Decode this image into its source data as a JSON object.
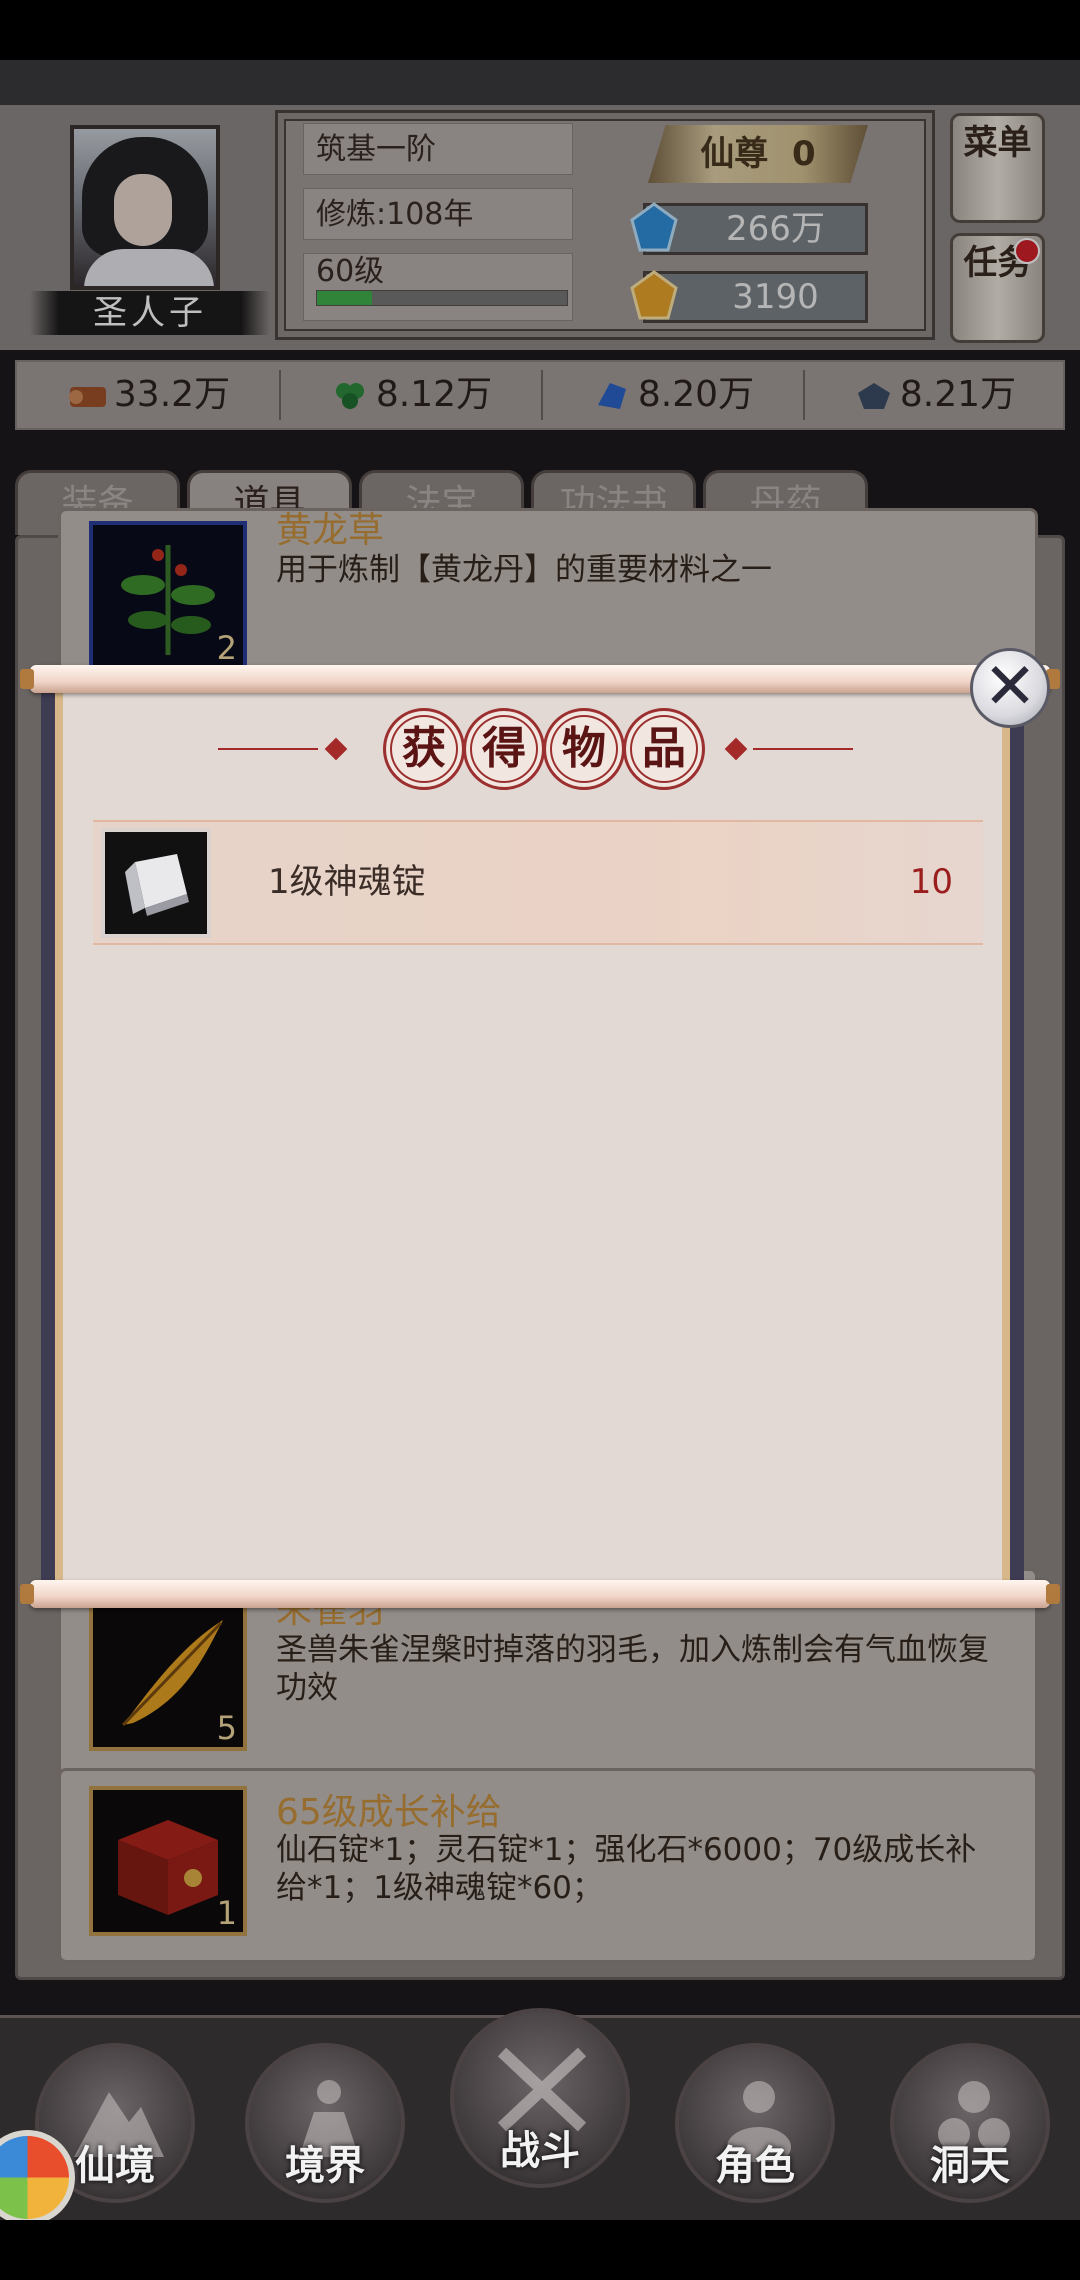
{
  "header": {
    "player_name": "圣人子",
    "realm": "筑基一阶",
    "cultivation": "修炼:108年",
    "level": "60级",
    "level_progress": 0.22,
    "rank_label": "仙尊",
    "rank_value": "0",
    "gems": [
      "266万",
      "3190"
    ],
    "side_buttons": [
      "菜单",
      "任务"
    ]
  },
  "resources": [
    "33.2万",
    "8.12万",
    "8.20万",
    "8.21万"
  ],
  "tabs": [
    "装备",
    "道具",
    "法宝",
    "功法书",
    "丹药"
  ],
  "active_tab": "道具",
  "items": [
    {
      "title": "黄龙草",
      "count": "2",
      "desc": "用于炼制【黄龙丹】的重要材料之一"
    },
    {
      "title": "朱雀羽",
      "count": "5",
      "desc": "圣兽朱雀涅槃时掉落的羽毛，加入炼制会有气血恢复功效"
    },
    {
      "title": "65级成长补给",
      "count": "1",
      "desc": "仙石锭*1；灵石锭*1；强化石*6000；70级成长补给*1；1级神魂锭*60；"
    }
  ],
  "dialog": {
    "title_chars": [
      "获",
      "得",
      "物",
      "品"
    ],
    "reward": {
      "name": "1级神魂锭",
      "qty": "10"
    },
    "close_icon": "close-icon"
  },
  "nav": [
    "仙境",
    "境界",
    "战斗",
    "角色",
    "洞天"
  ],
  "colors": {
    "accent_red": "#9b1e1e",
    "exp_green": "#3fb04d",
    "item_title_gold": "#c8923e"
  }
}
